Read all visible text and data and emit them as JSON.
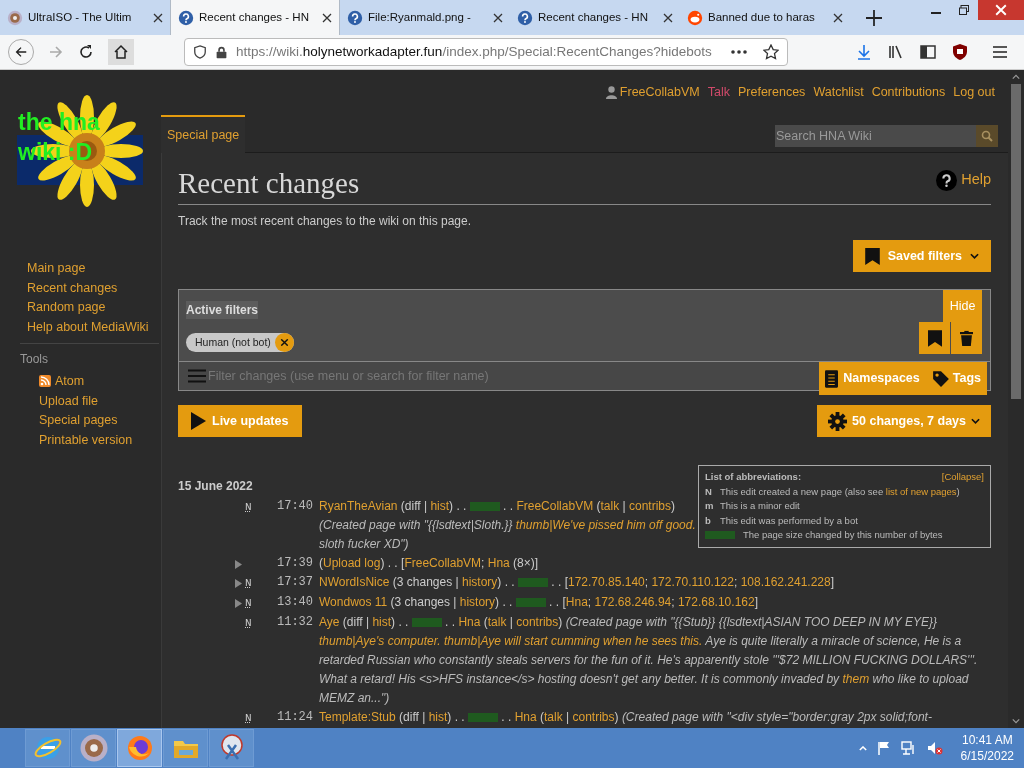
{
  "browser": {
    "tabs": [
      {
        "title": "UltraISO - The Ultim",
        "kind": "disc",
        "selected": false
      },
      {
        "title": "Recent changes - HN",
        "kind": "help",
        "selected": true
      },
      {
        "title": "File:Ryanmald.png -",
        "kind": "help",
        "selected": false
      },
      {
        "title": "Recent changes - HN",
        "kind": "help",
        "selected": false
      },
      {
        "title": "Banned due to haras",
        "kind": "alien",
        "selected": false
      }
    ],
    "url": {
      "prefix": "https://wiki.",
      "domain": "holynetworkadapter.fun",
      "path": "/index.php/Special:RecentChanges?hidebots"
    }
  },
  "wiki": {
    "logo": [
      "the hna",
      "wiki :D"
    ],
    "personal": [
      {
        "text": "FreeCollabVM",
        "kind": "user"
      },
      {
        "text": "Talk",
        "kind": "redlink"
      },
      {
        "text": "Preferences",
        "kind": "link"
      },
      {
        "text": "Watchlist",
        "kind": "link"
      },
      {
        "text": "Contributions",
        "kind": "link"
      },
      {
        "text": "Log out",
        "kind": "link"
      }
    ],
    "tab": "Special page",
    "search": {
      "placeholder": "Search HNA Wiki"
    },
    "navigation": [
      "Main page",
      "Recent changes",
      "Random page",
      "Help about MediaWiki"
    ],
    "tools": {
      "heading": "Tools",
      "items": [
        {
          "text": "Atom",
          "kind": "feed"
        },
        {
          "text": "Upload file",
          "kind": "link"
        },
        {
          "text": "Special pages",
          "kind": "link"
        },
        {
          "text": "Printable version",
          "kind": "link"
        }
      ]
    },
    "title": "Recent changes",
    "help": "Help",
    "description": "Track the most recent changes to the wiki on this page.",
    "saved_filters": "Saved filters",
    "filters": {
      "label": "Active filters",
      "chips": [
        "Human (not bot)"
      ],
      "hide": "Hide",
      "placeholder": "Filter changes (use menu or search for filter name)",
      "namespaces": "Namespaces",
      "tags": "Tags"
    },
    "live_updates": "Live updates",
    "limits": "50 changes, 7 days",
    "legend": {
      "title": "List of abbreviations:",
      "collapse": "[Collapse]",
      "rows": [
        {
          "kind": "flag",
          "key": "N",
          "text": "This edit created a new page (also see ",
          "link": "list of new pages",
          "after": ")"
        },
        {
          "kind": "flag",
          "key": "m",
          "text": "This is a minor edit"
        },
        {
          "kind": "flag",
          "key": "b",
          "text": "This edit was performed by a bot"
        },
        {
          "kind": "size",
          "text": "The page size changed by this number of bytes"
        }
      ]
    },
    "date": "15 June 2022",
    "changes": [
      {
        "flag": "N",
        "time": "17:40",
        "parts": [
          {
            "kind": "link",
            "text": "RyanTheAvian"
          },
          {
            "kind": "text",
            "text": " (diff | "
          },
          {
            "kind": "link",
            "text": "hist"
          },
          {
            "kind": "text",
            "text": ") . . "
          },
          {
            "kind": "size"
          },
          {
            "kind": "text",
            "text": " . . "
          },
          {
            "kind": "link",
            "text": "FreeCollabVM"
          },
          {
            "kind": "text",
            "text": " ("
          },
          {
            "kind": "link",
            "text": "talk"
          },
          {
            "kind": "text",
            "text": " | "
          },
          {
            "kind": "link",
            "text": "contribs"
          },
          {
            "kind": "text",
            "text": ") "
          },
          {
            "kind": "summary",
            "text": "(Created page with \"{{lsdtext|Sloth.}} "
          },
          {
            "kind": "summary-link",
            "text": "thumb|We've pissed him off good."
          },
          {
            "kind": "summary",
            "text": " sloth fucker XD\")"
          }
        ]
      },
      {
        "expanded": false,
        "time": "17:39",
        "parts": [
          {
            "kind": "text",
            "text": "("
          },
          {
            "kind": "link",
            "text": "Upload log"
          },
          {
            "kind": "text",
            "text": ") . . ["
          },
          {
            "kind": "link",
            "text": "FreeCollabVM"
          },
          {
            "kind": "text",
            "text": "; "
          },
          {
            "kind": "link",
            "text": "Hna"
          },
          {
            "kind": "text",
            "text": " (8×)]"
          }
        ]
      },
      {
        "expanded": false,
        "flag": "N",
        "time": "17:37",
        "parts": [
          {
            "kind": "link",
            "text": "NWordIsNice"
          },
          {
            "kind": "text",
            "text": " (3 changes | "
          },
          {
            "kind": "link",
            "text": "history"
          },
          {
            "kind": "text",
            "text": ") . . "
          },
          {
            "kind": "size"
          },
          {
            "kind": "text",
            "text": " . . ["
          },
          {
            "kind": "link",
            "text": "172.70.85.140"
          },
          {
            "kind": "text",
            "text": "; "
          },
          {
            "kind": "link",
            "text": "172.70.110.122"
          },
          {
            "kind": "text",
            "text": "; "
          },
          {
            "kind": "link",
            "text": "108.162.241.228"
          },
          {
            "kind": "text",
            "text": "]"
          }
        ]
      },
      {
        "expanded": false,
        "flag": "N",
        "time": "13:40",
        "parts": [
          {
            "kind": "link",
            "text": "Wondwos 11"
          },
          {
            "kind": "text",
            "text": " (3 changes | "
          },
          {
            "kind": "link",
            "text": "history"
          },
          {
            "kind": "text",
            "text": ") . . "
          },
          {
            "kind": "size"
          },
          {
            "kind": "text",
            "text": " . . ["
          },
          {
            "kind": "link",
            "text": "Hna"
          },
          {
            "kind": "text",
            "text": "; "
          },
          {
            "kind": "link",
            "text": "172.68.246.94"
          },
          {
            "kind": "text",
            "text": "; "
          },
          {
            "kind": "link",
            "text": "172.68.10.162"
          },
          {
            "kind": "text",
            "text": "]"
          }
        ]
      },
      {
        "flag": "N",
        "time": "11:32",
        "parts": [
          {
            "kind": "link",
            "text": "Aye"
          },
          {
            "kind": "text",
            "text": " (diff | "
          },
          {
            "kind": "link",
            "text": "hist"
          },
          {
            "kind": "text",
            "text": ") . . "
          },
          {
            "kind": "size"
          },
          {
            "kind": "text",
            "text": " . . "
          },
          {
            "kind": "link",
            "text": "Hna"
          },
          {
            "kind": "text",
            "text": " ("
          },
          {
            "kind": "link",
            "text": "talk"
          },
          {
            "kind": "text",
            "text": " | "
          },
          {
            "kind": "link",
            "text": "contribs"
          },
          {
            "kind": "text",
            "text": ") "
          },
          {
            "kind": "summary",
            "text": "(Created page with \"{{Stub}} {{lsdtext|ASIAN TOO DEEP IN MY EYE}} "
          },
          {
            "kind": "summary-link",
            "text": "thumb|Aye's computer. thumb|Aye will start cumming when he sees this."
          },
          {
            "kind": "summary",
            "text": " Aye is quite literally a miracle of science, He is a retarded Russian who constantly steals servers for the fun of it. He's apparently stole '''$72 MILLION FUCKING DOLLARS'''. What a retard! His <s>HFS instance</s> hosting doesn't get any better. It is commonly invaded by "
          },
          {
            "kind": "summary-link",
            "text": "them"
          },
          {
            "kind": "summary",
            "text": " who like to upload MEMZ an...\")"
          }
        ]
      },
      {
        "flag": "N",
        "time": "11:24",
        "parts": [
          {
            "kind": "link",
            "text": "Template:Stub"
          },
          {
            "kind": "text",
            "text": " (diff | "
          },
          {
            "kind": "link",
            "text": "hist"
          },
          {
            "kind": "text",
            "text": ") . . "
          },
          {
            "kind": "size"
          },
          {
            "kind": "text",
            "text": " . . "
          },
          {
            "kind": "link",
            "text": "Hna"
          },
          {
            "kind": "text",
            "text": " ("
          },
          {
            "kind": "link",
            "text": "talk"
          },
          {
            "kind": "text",
            "text": " | "
          },
          {
            "kind": "link",
            "text": "contribs"
          },
          {
            "kind": "text",
            "text": ") "
          },
          {
            "kind": "summary",
            "text": "(Created page with \"<div style=\"border:gray 2px solid;font-"
          }
        ]
      }
    ]
  },
  "taskbar": {
    "apps": [
      {
        "kind": "globe",
        "active": false
      },
      {
        "kind": "disc",
        "active": false
      },
      {
        "kind": "fox",
        "active": true
      },
      {
        "kind": "folder",
        "active": false
      },
      {
        "kind": "scissors",
        "active": false
      }
    ],
    "time": "10:41 AM",
    "date": "6/15/2022"
  }
}
